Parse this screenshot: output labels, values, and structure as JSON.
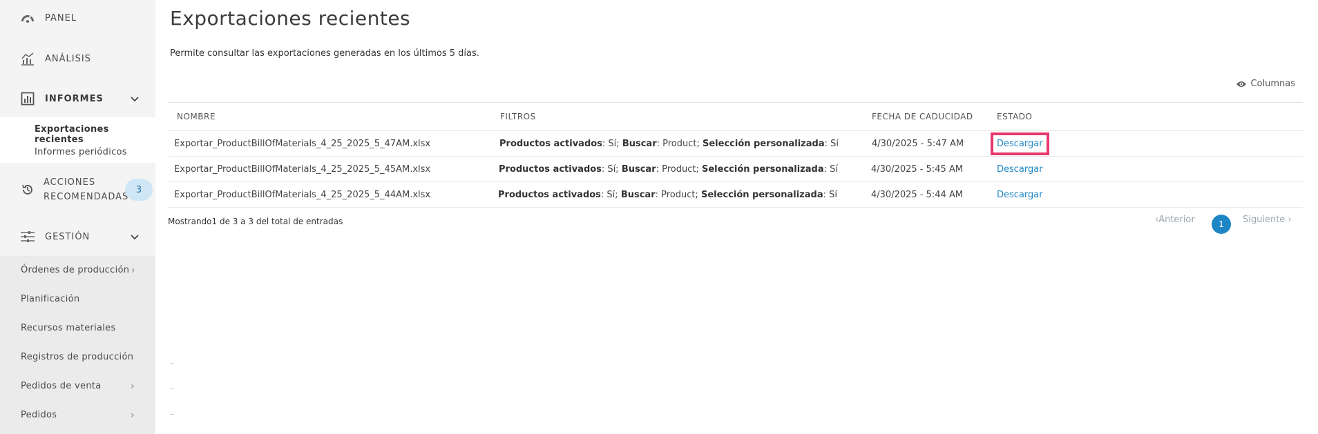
{
  "sidebar": {
    "panel": "PANEL",
    "analisis": "ANÁLISIS",
    "informes": "INFORMES",
    "informes_sub": [
      "Exportaciones recientes",
      "Informes periódicos"
    ],
    "acciones_line1": "ACCIONES",
    "acciones_line2": "RECOMENDADAS",
    "acciones_badge": "3",
    "gestion": "GESTIÓN",
    "gestion_items": [
      "Órdenes de producción",
      "Planificación",
      "Recursos materiales",
      "Registros de producción",
      "Pedidos de venta",
      "Pedidos"
    ]
  },
  "main": {
    "title": "Exportaciones recientes",
    "subtitle": "Permite consultar las exportaciones generadas en los últimos 5 días.",
    "columns_label": "Columnas",
    "headers": [
      "NOMBRE",
      "FILTROS",
      "FECHA DE CADUCIDAD",
      "ESTADO"
    ],
    "filter_labels": {
      "activados": "Productos activados",
      "buscar": "Buscar",
      "seleccion": "Selección personalizada"
    },
    "rows": [
      {
        "nombre": "Exportar_ProductBillOfMaterials_4_25_2025_5_47AM.xlsx",
        "activados": ": Sí; ",
        "buscar": ": Product; ",
        "seleccion": ": Sí",
        "fecha": "4/30/2025 - 5:47 AM",
        "estado": "Descargar"
      },
      {
        "nombre": "Exportar_ProductBillOfMaterials_4_25_2025_5_45AM.xlsx",
        "activados": ": Sí; ",
        "buscar": ": Product; ",
        "seleccion": ": Sí",
        "fecha": "4/30/2025 - 5:45 AM",
        "estado": "Descargar"
      },
      {
        "nombre": "Exportar_ProductBillOfMaterials_4_25_2025_5_44AM.xlsx",
        "activados": ": Sí; ",
        "buscar": ": Product; ",
        "seleccion": ": Sí",
        "fecha": "4/30/2025 - 5:44 AM",
        "estado": "Descargar"
      }
    ],
    "footer": "Mostrando1 de 3 a 3 del total de entradas",
    "pager": {
      "prev": "Anterior",
      "current": "1",
      "next": "Siguiente"
    }
  }
}
